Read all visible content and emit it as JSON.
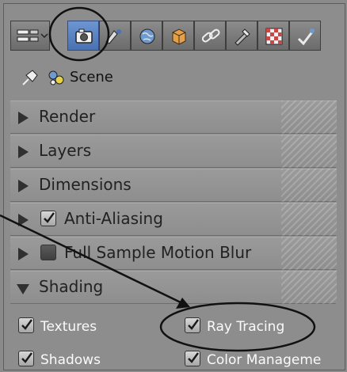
{
  "toolbar": {
    "buttons": [
      {
        "icon": "view-switcher-icon"
      },
      {
        "icon": "camera-render-icon",
        "active": true
      },
      {
        "icon": "render-layers-icon"
      },
      {
        "icon": "world-icon"
      },
      {
        "icon": "object-icon"
      },
      {
        "icon": "constraints-icon"
      },
      {
        "icon": "modifiers-icon"
      },
      {
        "icon": "texture-icon"
      },
      {
        "icon": "physics-icon"
      }
    ]
  },
  "context": {
    "scene_label": "Scene"
  },
  "panels": [
    {
      "title": "Render",
      "expanded": false
    },
    {
      "title": "Layers",
      "expanded": false
    },
    {
      "title": "Dimensions",
      "expanded": false
    },
    {
      "title": "Anti-Aliasing",
      "expanded": false,
      "checkbox": true,
      "checked": true
    },
    {
      "title": "Full Sample Motion Blur",
      "expanded": false,
      "checkbox": true,
      "checked": false
    },
    {
      "title": "Shading",
      "expanded": true
    }
  ],
  "shading_options": [
    {
      "label": "Textures",
      "checked": true
    },
    {
      "label": "Ray Tracing",
      "checked": true
    },
    {
      "label": "Shadows",
      "checked": true
    },
    {
      "label": "Color Manageme",
      "checked": true
    }
  ],
  "colors": {
    "panel_bg": "#8d8d8d",
    "active_tab": "#5a82c2",
    "annotation": "#111111"
  }
}
